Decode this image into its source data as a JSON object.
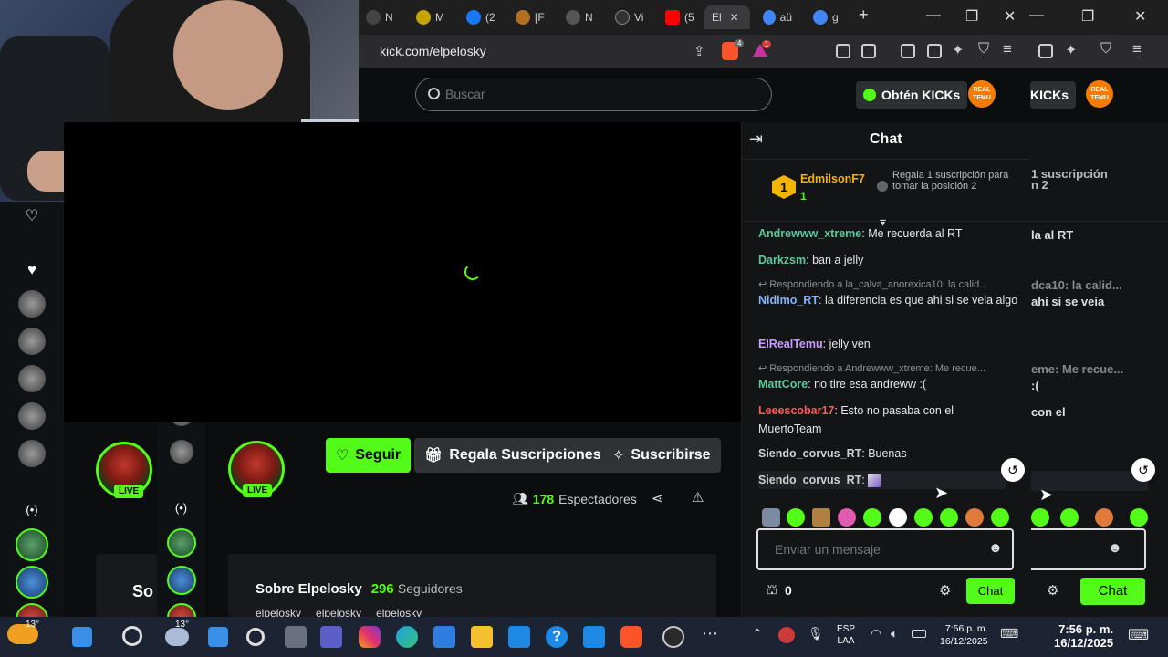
{
  "browser": {
    "tabs": [
      {
        "label": "N",
        "color": "#444"
      },
      {
        "label": "M",
        "color": "#c8a400"
      },
      {
        "label": "(2",
        "color": "#1877f2"
      },
      {
        "label": "[F",
        "color": "#b07020"
      },
      {
        "label": "N",
        "color": "#555"
      },
      {
        "label": "Vi",
        "color": "#333"
      },
      {
        "label": "(5",
        "color": "#ff0000"
      },
      {
        "label": "El",
        "color": "#53fc18"
      },
      {
        "label": "aü",
        "color": "#4285f4"
      },
      {
        "label": "g",
        "color": "#4285f4"
      }
    ],
    "url": "kick.com/elpelosky",
    "brave_badge": "4",
    "alert_badge": "1"
  },
  "header": {
    "search_placeholder": "Buscar",
    "get_kicks": "Obtén KICKs",
    "get_kicks_clipped": "KICKs",
    "avatar_text": "REAL TEMU"
  },
  "stream": {
    "live_badge": "LIVE",
    "follow_label": "Seguir",
    "gift_label": "Regala Suscripciones",
    "subscribe_label": "Suscribirse",
    "viewers": "178",
    "viewers_label": "Espectadores",
    "about_title": "Sobre Elpelosky",
    "followers": "296",
    "followers_label": "Seguidores",
    "socials": [
      "elpelosky",
      "elpelosky",
      "elpelosky"
    ],
    "side_partial": "So"
  },
  "chat": {
    "title": "Chat",
    "leader_name": "EdmilsonF7",
    "leader_count": "1",
    "leader_rank": "1",
    "gift_prompt": "Regala 1 suscripción para tomar la posición 2",
    "gift_prompt_clipped": "1 suscripción\nn 2",
    "messages": [
      {
        "user": "Andrewww_xtreme",
        "color": "#5ec89a",
        "text": "Me recuerda al RT"
      },
      {
        "user": "Darkzsm",
        "color": "#5ec89a",
        "text": "ban a jelly"
      },
      {
        "reply": "Respondiendo a la_calva_anorexica10: la calid..."
      },
      {
        "user": "Nidimo_RT",
        "color": "#7fb6ff",
        "text": "la diferencia es que ahi si se veia algo"
      },
      {
        "user": "ElRealTemu",
        "color": "#c79bff",
        "text": "jelly ven"
      },
      {
        "reply": "Respondiendo a Andrewww_xtreme: Me recue..."
      },
      {
        "user": "MattCore",
        "color": "#5ec89a",
        "text": "no tire esa andreww :("
      },
      {
        "user": "Leeescobar17",
        "color": "#ff5a5a",
        "text": "Esto no pasaba con el MuertoTeam"
      },
      {
        "user": "Siendo_corvus_RT",
        "color": "#cfcfcf",
        "text": "Buenas"
      },
      {
        "user": "Siendo_corvus_RT",
        "color": "#cfcfcf",
        "text": ""
      }
    ],
    "clipped_lines": [
      "la al RT",
      "dca10: la calid...",
      "ahi si se veia",
      "eme: Me recue...",
      ":(",
      "con el"
    ],
    "input_placeholder": "Enviar un mensaje",
    "points": "0",
    "send_label": "Chat"
  },
  "taskbar": {
    "weather": "13°",
    "lang1": "ESP",
    "lang2": "LAA",
    "time": "7:56 p. m.",
    "date": "16/12/2025"
  }
}
